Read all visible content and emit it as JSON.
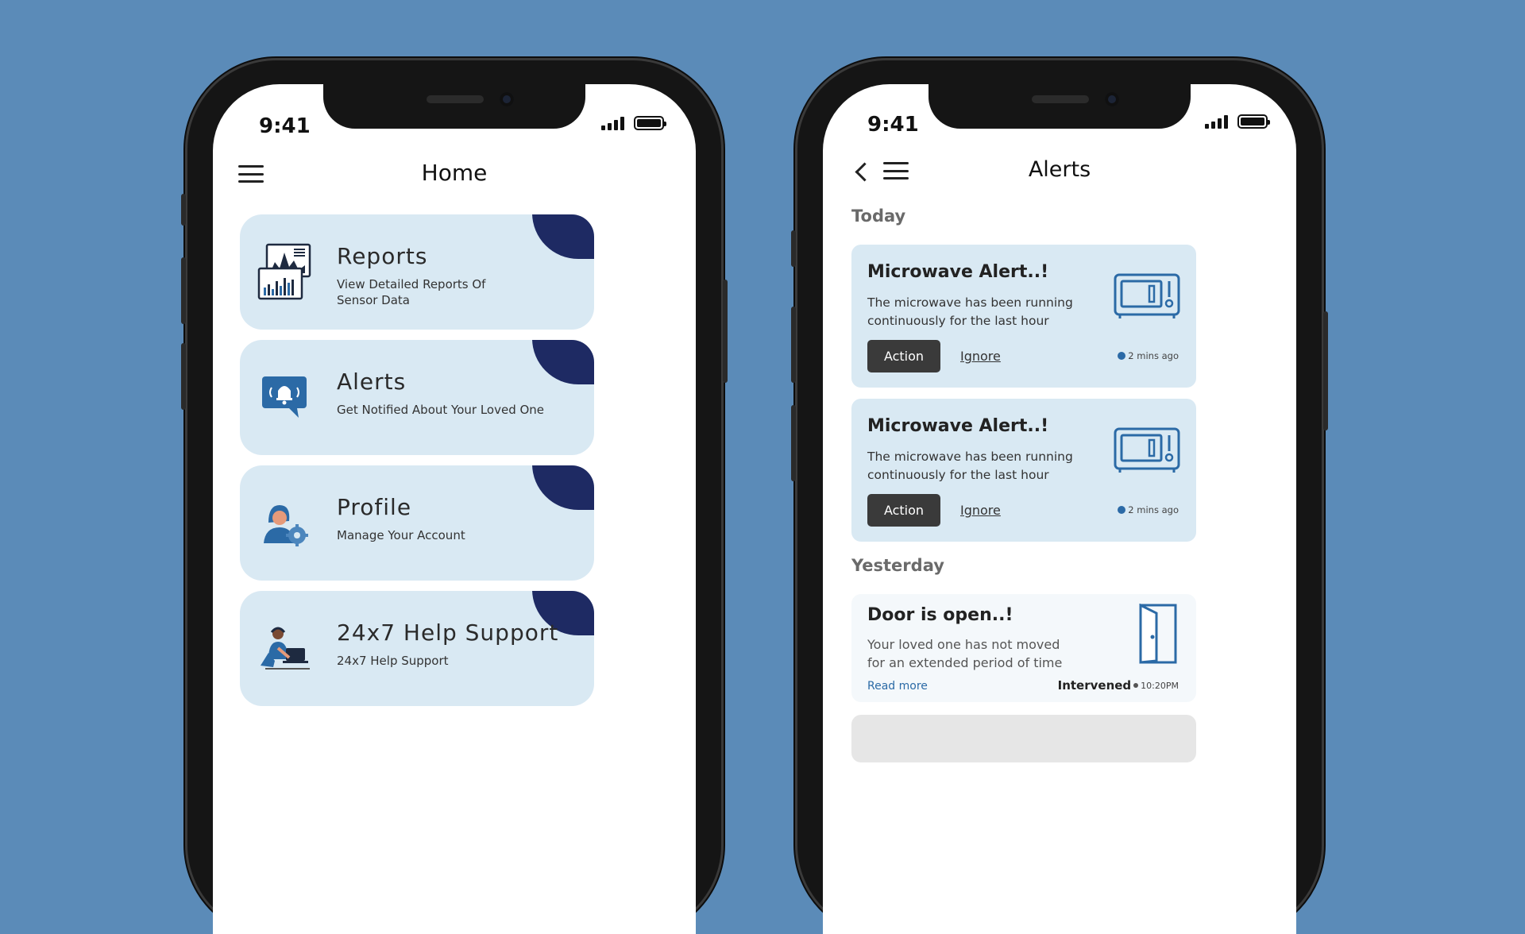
{
  "status_bar": {
    "time": "9:41"
  },
  "home": {
    "title": "Home",
    "cards": [
      {
        "title": "Reports",
        "subtitle": "View Detailed Reports Of Sensor Data",
        "icon": "reports-chart-icon"
      },
      {
        "title": "Alerts",
        "subtitle": "Get Notified About Your Loved One",
        "icon": "bell-alert-icon"
      },
      {
        "title": "Profile",
        "subtitle": "Manage Your Account",
        "icon": "profile-settings-icon"
      },
      {
        "title": "24x7 Help Support",
        "subtitle": "24x7 Help Support",
        "icon": "support-agent-icon"
      }
    ]
  },
  "alerts": {
    "title": "Alerts",
    "sections": {
      "today": "Today",
      "yesterday": "Yesterday"
    },
    "today_items": [
      {
        "title": "Microwave Alert..!",
        "body": "The microwave has been running continuously for the last hour",
        "action": "Action",
        "ignore": "Ignore",
        "time": "2 mins ago",
        "icon": "microwave-icon"
      },
      {
        "title": "Microwave Alert..!",
        "body": "The microwave has been running continuously for the last hour",
        "action": "Action",
        "ignore": "Ignore",
        "time": "2 mins ago",
        "icon": "microwave-icon"
      }
    ],
    "yesterday_items": [
      {
        "title": "Door is open..!",
        "body": "Your loved one has not moved for an extended period of time",
        "read_more": "Read more",
        "status": "Intervened",
        "time": "10:20PM",
        "icon": "door-open-icon"
      }
    ]
  },
  "colors": {
    "background": "#5b8bb8",
    "card": "#d9e9f3",
    "accent_navy": "#1e2a63",
    "button_dark": "#3a3a3a",
    "link_blue": "#2b6aa6"
  }
}
